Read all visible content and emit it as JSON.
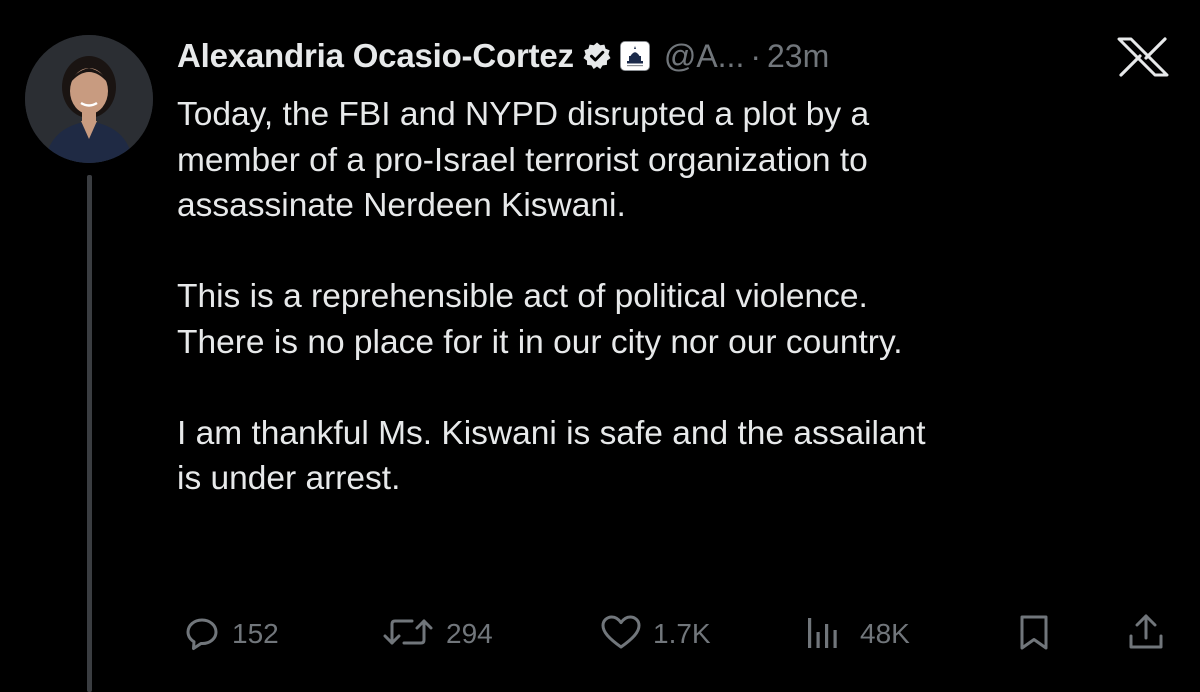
{
  "author": {
    "display_name": "Alexandria Ocasio-Cortez",
    "handle": "@A...",
    "separator": "·",
    "time": "23m",
    "verified_icon": "verified-badge-icon",
    "affiliation_icon": "capitol-affiliation-badge-icon"
  },
  "brand_icon": "x-logo-icon",
  "tweet": {
    "text": "Today, the FBI and NYPD disrupted a plot by a\nmember of a pro-Israel terrorist organization to\nassassinate Nerdeen Kiswani.\n\nThis is a reprehensible act of political violence.\nThere is no place for it in our city nor our country.\n\nI am thankful Ms. Kiswani is safe and the assailant\nis under arrest."
  },
  "actions": {
    "replies": {
      "icon": "reply-icon",
      "count": "152"
    },
    "reposts": {
      "icon": "repost-icon",
      "count": "294"
    },
    "likes": {
      "icon": "heart-icon",
      "count": "1.7K"
    },
    "views": {
      "icon": "views-icon",
      "count": "48K"
    },
    "bookmark": {
      "icon": "bookmark-icon"
    },
    "share": {
      "icon": "share-icon"
    }
  },
  "colors": {
    "background": "#000000",
    "primary_text": "#e7e9ea",
    "secondary_text": "#71767b",
    "thread_line": "#3a3d41"
  }
}
